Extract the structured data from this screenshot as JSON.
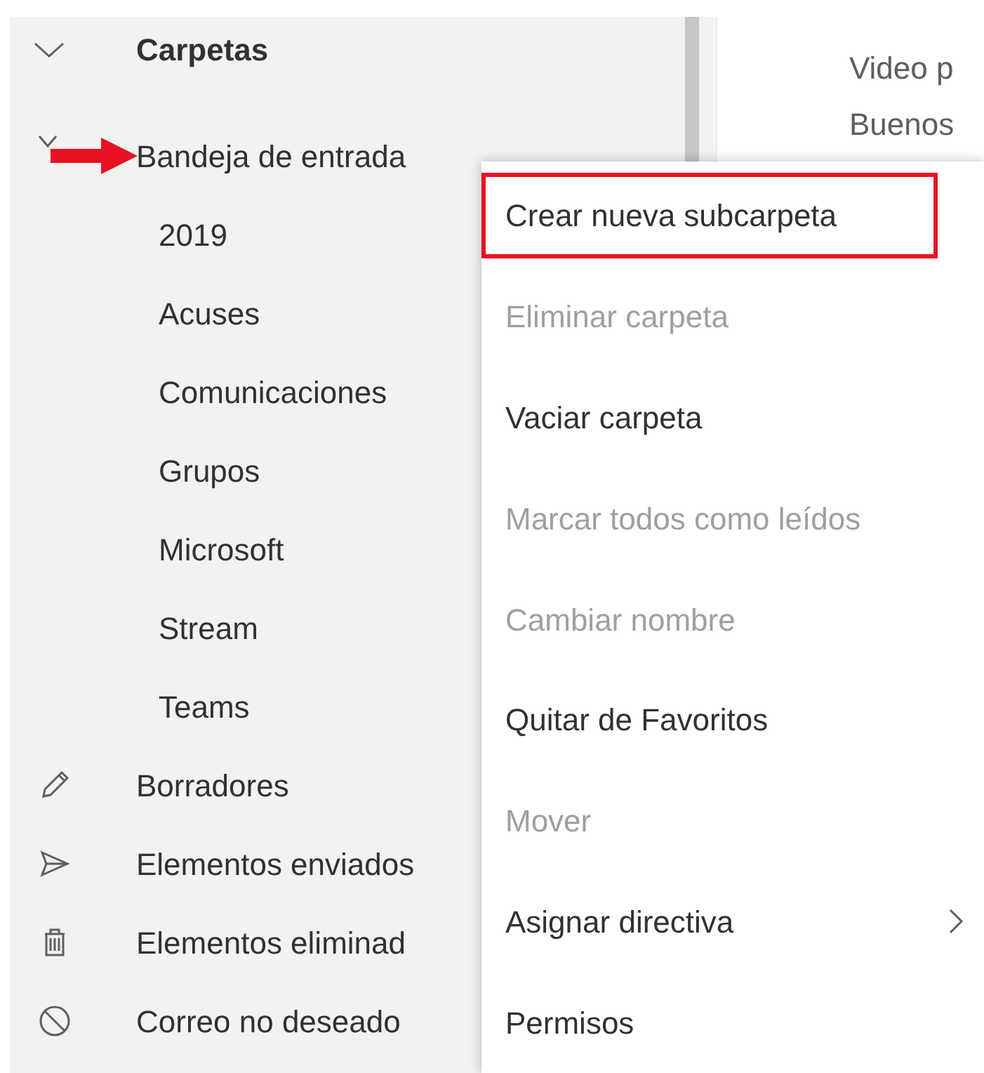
{
  "folders": {
    "label": "Carpetas",
    "expanded": true,
    "items": [
      {
        "label": "Bandeja de entrada",
        "kind": "inbox",
        "expanded": true,
        "children": [
          {
            "label": "2019"
          },
          {
            "label": "Acuses"
          },
          {
            "label": "Comunicaciones"
          },
          {
            "label": "Grupos"
          },
          {
            "label": "Microsoft"
          },
          {
            "label": "Stream"
          },
          {
            "label": "Teams"
          }
        ]
      },
      {
        "label": "Borradores",
        "kind": "drafts"
      },
      {
        "label": "Elementos enviados",
        "kind": "sent"
      },
      {
        "label": "Elementos eliminad",
        "kind": "deleted"
      },
      {
        "label": "Correo no deseado",
        "kind": "junk"
      }
    ]
  },
  "message_preview": {
    "lines": [
      "Video p",
      "Buenos"
    ]
  },
  "context_menu": {
    "items": [
      {
        "label": "Crear nueva subcarpeta",
        "disabled": false,
        "highlighted": true,
        "submenu": false
      },
      {
        "label": "Eliminar carpeta",
        "disabled": true,
        "highlighted": false,
        "submenu": false
      },
      {
        "label": "Vaciar carpeta",
        "disabled": false,
        "highlighted": false,
        "submenu": false
      },
      {
        "label": "Marcar todos como leídos",
        "disabled": true,
        "highlighted": false,
        "submenu": false
      },
      {
        "label": "Cambiar nombre",
        "disabled": true,
        "highlighted": false,
        "submenu": false
      },
      {
        "label": "Quitar de Favoritos",
        "disabled": false,
        "highlighted": false,
        "submenu": false
      },
      {
        "label": "Mover",
        "disabled": true,
        "highlighted": false,
        "submenu": false
      },
      {
        "label": "Asignar directiva",
        "disabled": false,
        "highlighted": false,
        "submenu": true
      },
      {
        "label": "Permisos",
        "disabled": false,
        "highlighted": false,
        "submenu": false
      }
    ]
  },
  "annotations": {
    "arrow": true
  }
}
